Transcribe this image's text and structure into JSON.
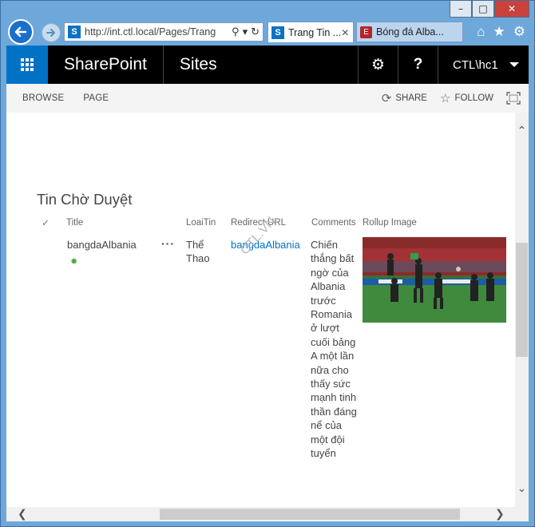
{
  "window": {
    "controls": [
      "–",
      "□",
      "✕"
    ]
  },
  "browser": {
    "address": "http://int.ctl.local/Pages/Trang",
    "tabs": [
      {
        "label": "Trang Tin ...",
        "close": "✕"
      },
      {
        "label": "Bóng đá Alba...",
        "icon": "newspaper-icon"
      }
    ],
    "icons": [
      "home-icon",
      "star-icon",
      "gear-icon"
    ]
  },
  "suitebar": {
    "brand": "SharePoint",
    "sites": "Sites",
    "help": "?",
    "user": "CTL\\hc1"
  },
  "ribbon": {
    "tabs": [
      "BROWSE",
      "PAGE"
    ],
    "share": "SHARE",
    "follow": "FOLLOW"
  },
  "list": {
    "title": "Tin Chờ Duyệt",
    "columns": [
      "Title",
      "LoaiTin",
      "Redirect URL",
      "Comments",
      "Rollup Image"
    ],
    "row": {
      "title": "bangdaAlbania",
      "loaitin": "Thể Thao",
      "redirect_url": "bangdaAlbania",
      "comments": "Chiến thắng bất ngờ của Albania trước Romania ở lượt cuối bảng A một lần nữa cho thấy sức mạnh tinh thần đáng nể của một đội tuyển"
    }
  },
  "watermark": "CTL.VN"
}
